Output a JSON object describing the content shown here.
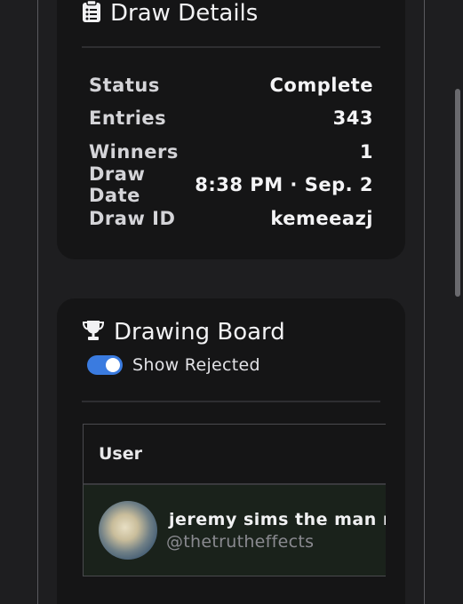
{
  "draw_details": {
    "title": "Draw Details",
    "icon": "clipboard-list-icon",
    "rows": [
      {
        "label": "Status",
        "value": "Complete"
      },
      {
        "label": "Entries",
        "value": "343"
      },
      {
        "label": "Winners",
        "value": "1"
      },
      {
        "label": "Draw Date",
        "value": "8:38 PM · Sep. 2"
      },
      {
        "label": "Draw ID",
        "value": "kemeeazj"
      }
    ]
  },
  "drawing_board": {
    "title": "Drawing Board",
    "icon": "trophy-icon",
    "show_rejected": {
      "label": "Show Rejected",
      "checked": true
    },
    "table": {
      "header": "User",
      "rows": [
        {
          "name": "jeremy sims the man m",
          "handle": "@thetrutheffects"
        }
      ]
    }
  },
  "colors": {
    "accent": "#3a7be0",
    "card": "#151516",
    "background": "#1e1e20"
  }
}
